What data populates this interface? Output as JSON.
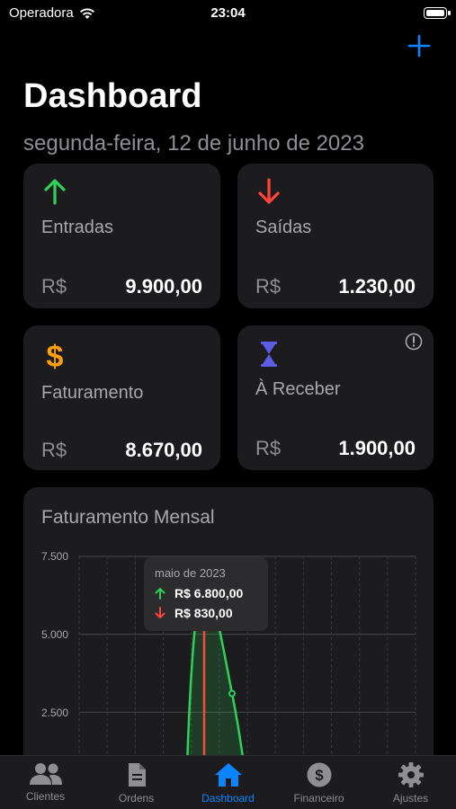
{
  "status_bar": {
    "carrier": "Operadora",
    "time": "23:04"
  },
  "header": {
    "title": "Dashboard",
    "date": "segunda-feira, 12 de junho de 2023"
  },
  "cards": {
    "entradas": {
      "label": "Entradas",
      "currency": "R$",
      "amount": "9.900,00",
      "icon": "arrow-up-icon",
      "color": "#30d158"
    },
    "saidas": {
      "label": "Saídas",
      "currency": "R$",
      "amount": "1.230,00",
      "icon": "arrow-down-icon",
      "color": "#ff453a"
    },
    "faturamento": {
      "label": "Faturamento",
      "currency": "R$",
      "amount": "8.670,00",
      "icon": "dollar-icon",
      "color": "#ff9f0a"
    },
    "receber": {
      "label": "À Receber",
      "currency": "R$",
      "amount": "1.900,00",
      "icon": "hourglass-icon",
      "color": "#5e5ce6"
    }
  },
  "chart": {
    "title": "Faturamento Mensal",
    "y_ticks": [
      "7.500",
      "5.000",
      "2.500"
    ],
    "tooltip": {
      "month": "maio de 2023",
      "in_value": "R$ 6.800,00",
      "out_value": "R$ 830,00"
    }
  },
  "chart_data": {
    "type": "area",
    "title": "Faturamento Mensal",
    "ylim": [
      0,
      7500
    ],
    "grid": true,
    "highlighted": {
      "label": "maio de 2023",
      "entradas": 6800,
      "saidas": 830
    },
    "series": [
      {
        "values": [
          0,
          6800,
          3100,
          0
        ]
      }
    ]
  },
  "tabbar": {
    "tabs": [
      {
        "label": "Clientes",
        "icon": "people-icon"
      },
      {
        "label": "Ordens",
        "icon": "document-icon"
      },
      {
        "label": "Dashboard",
        "icon": "house-icon"
      },
      {
        "label": "Financeiro",
        "icon": "dollar-circle-icon"
      },
      {
        "label": "Ajustes",
        "icon": "gear-icon"
      }
    ],
    "active": "Dashboard"
  },
  "colors": {
    "accent": "#0a84ff",
    "green": "#30d158",
    "red": "#ff453a",
    "orange": "#ff9f0a",
    "purple": "#5e5ce6"
  }
}
